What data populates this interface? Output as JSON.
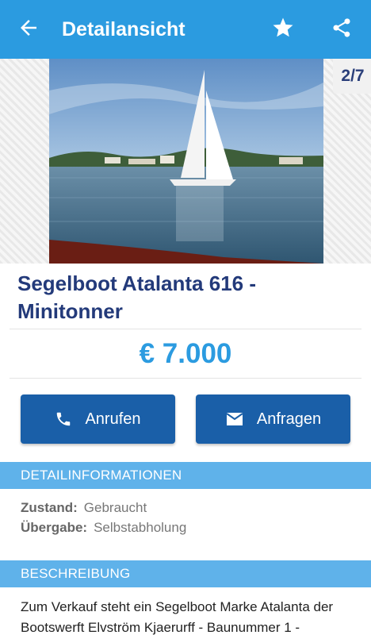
{
  "appbar": {
    "title": "Detailansicht",
    "icons": [
      "arrow-back-icon",
      "star-icon",
      "share-icon"
    ],
    "color": "#2b9be0"
  },
  "gallery": {
    "counter": "2/7"
  },
  "listing": {
    "title": "Segelboot Atalanta 616 - Minitonner",
    "price": "€ 7.000"
  },
  "actions": {
    "call_label": "Anrufen",
    "inquire_label": "Anfragen",
    "color": "#1a5fa8"
  },
  "details": {
    "header": "DETAILINFORMATIONEN",
    "rows": [
      {
        "label": "Zustand:",
        "value": "Gebraucht"
      },
      {
        "label": "Übergabe:",
        "value": "Selbstabholung"
      }
    ]
  },
  "description": {
    "header": "BESCHREIBUNG",
    "text": "Zum Verkauf steht ein Segelboot Marke Atalanta der Bootswerft Elvström Kjaerurff - Baunummer 1 -"
  }
}
